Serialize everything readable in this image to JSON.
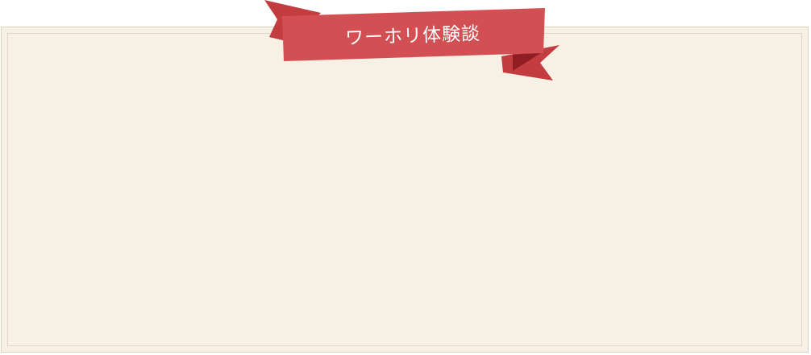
{
  "banner": {
    "title": "ワーホリ体験談",
    "colors": {
      "ribbon": "#d25053",
      "ribbon_fold": "#8f1d22",
      "ribbon_tail": "#b8363b",
      "card_background": "#f7f0e4",
      "card_border": "#ddd2bf"
    }
  }
}
